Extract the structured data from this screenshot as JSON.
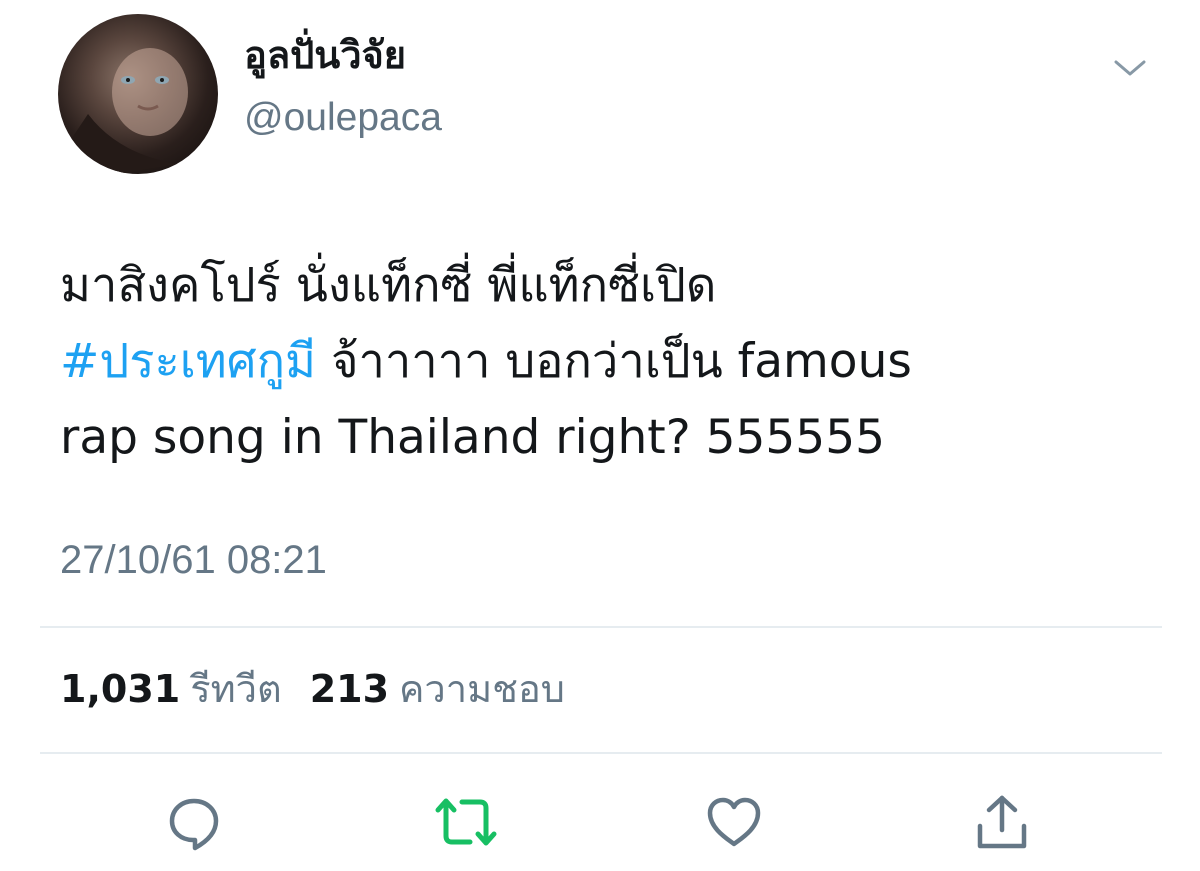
{
  "user": {
    "display_name": "อูลปั่นวิจัย",
    "handle": "@oulepaca"
  },
  "tweet": {
    "line1": "มาสิงคโปร์ นั่งแท็กซี่ พี่แท็กซี่เปิด",
    "hashtag": "#ประเทศกูมี",
    "line2_rest": " จ้าาาาา บอกว่าเป็น famous",
    "line3": "rap song in Thailand  right? 555555",
    "timestamp": "27/10/61 08:21"
  },
  "stats": {
    "retweets_count": "1,031",
    "retweets_label": "รีทวีต",
    "likes_count": "213",
    "likes_label": "ความชอบ"
  },
  "icons": {
    "reply": "comment-icon",
    "retweet": "retweet-icon",
    "like": "heart-icon",
    "share": "share-icon",
    "menu": "chevron-down-icon"
  },
  "colors": {
    "hashtag": "#1da1f2",
    "retweet_active": "#17bf63",
    "secondary_text": "#657786",
    "icon_gray": "#657786"
  }
}
